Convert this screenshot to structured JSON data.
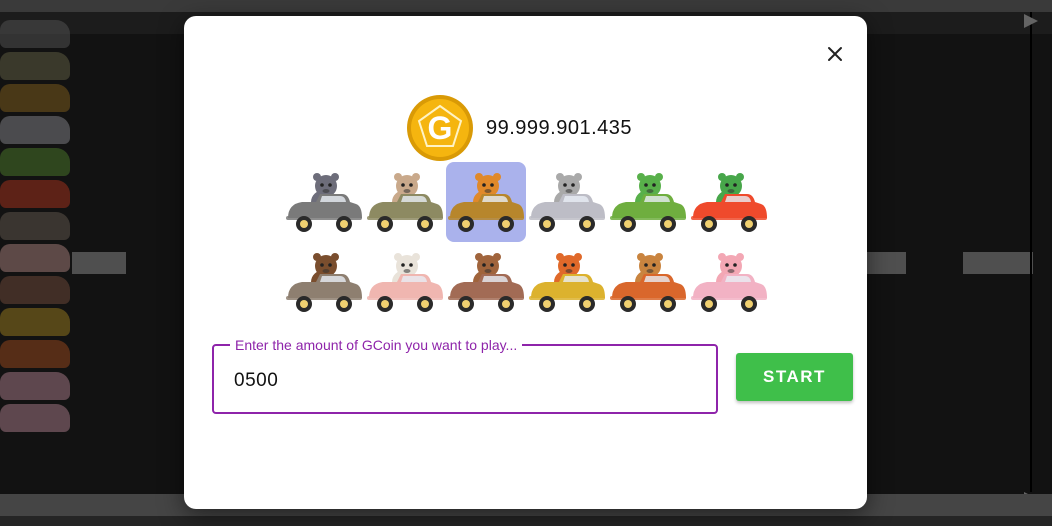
{
  "dialog": {
    "balance": "99.999.901.435",
    "coin_letter": "G",
    "coin_color": "#f5b50f",
    "amount_label": "Enter the amount of GCoin you want to play...",
    "amount_value": "0500",
    "start_label": "START",
    "accent_color": "#8e24aa",
    "start_color": "#3fbf4a"
  },
  "players": [
    [
      {
        "animal": "rat",
        "car_color": "#7a7a7a",
        "animal_color": "#6d6d7a",
        "selected": false
      },
      {
        "animal": "ox",
        "car_color": "#8d8a62",
        "animal_color": "#c9a98b",
        "selected": false
      },
      {
        "animal": "tiger",
        "car_color": "#b7862c",
        "animal_color": "#e0892a",
        "selected": true
      },
      {
        "animal": "cat",
        "car_color": "#bdbdc6",
        "animal_color": "#a9a9a9",
        "selected": false
      },
      {
        "animal": "dragon",
        "car_color": "#6fae3f",
        "animal_color": "#58b04a",
        "selected": false
      },
      {
        "animal": "snake",
        "car_color": "#ef4a2c",
        "animal_color": "#47a64a",
        "selected": false
      }
    ],
    [
      {
        "animal": "horse",
        "car_color": "#8e7f70",
        "animal_color": "#7a4e2e",
        "selected": false
      },
      {
        "animal": "goat",
        "car_color": "#f0b6b0",
        "animal_color": "#e9e3da",
        "selected": false
      },
      {
        "animal": "monkey",
        "car_color": "#a26b55",
        "animal_color": "#a0643c",
        "selected": false
      },
      {
        "animal": "rooster",
        "car_color": "#dcb22e",
        "animal_color": "#e0692a",
        "selected": false
      },
      {
        "animal": "dog",
        "car_color": "#d9672c",
        "animal_color": "#c9843f",
        "selected": false
      },
      {
        "animal": "pig",
        "car_color": "#f2b2c4",
        "animal_color": "#f3a7b4",
        "selected": false
      }
    ]
  ]
}
